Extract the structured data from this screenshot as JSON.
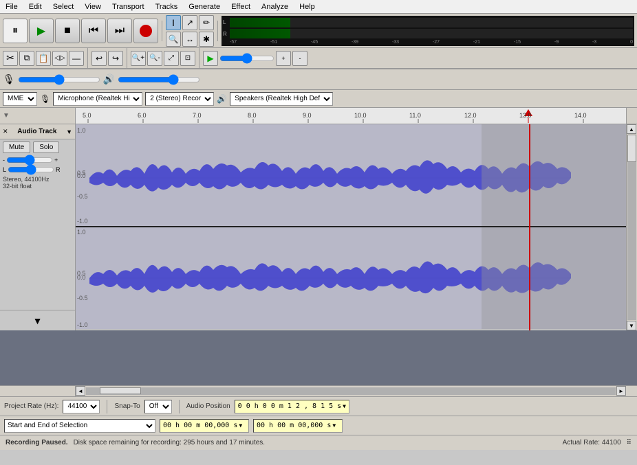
{
  "menu": {
    "items": [
      "File",
      "Edit",
      "Select",
      "View",
      "Transport",
      "Tracks",
      "Generate",
      "Effect",
      "Analyze",
      "Help"
    ]
  },
  "transport": {
    "pause_label": "⏸",
    "play_label": "▶",
    "stop_label": "■",
    "skip_start_label": "⏮",
    "skip_end_label": "⏭",
    "record_label": "⏺"
  },
  "tools": {
    "selection": "I",
    "envelope": "↗",
    "draw": "✏",
    "zoom_label": "🔍",
    "timeshift": "↔",
    "multi": "✱"
  },
  "vu_meter": {
    "l_label": "L",
    "r_label": "R",
    "scale": "-57 -54 -51 -48 -45 -42 -39 -36 -33 -30 -27 -24 -21 -18 -15 -12 -9 -6 -3 0"
  },
  "mixer": {
    "mic_icon": "🎙",
    "speaker_icon": "🔊",
    "mic_volume": 50,
    "speaker_volume": 70
  },
  "devices": {
    "api": "MME",
    "mic_icon": "🎙",
    "mic_device": "Microphone (Realtek High",
    "channels": "2 (Stereo) Recor",
    "speaker_icon": "🔊",
    "speaker_device": "Speakers (Realtek High Defi"
  },
  "ruler": {
    "marks": [
      "5.0",
      "6.0",
      "7.0",
      "8.0",
      "9.0",
      "10.0",
      "11.0",
      "12.0",
      "13.0",
      "14.0"
    ]
  },
  "track": {
    "name": "Audio Track",
    "mute_label": "Mute",
    "solo_label": "Solo",
    "gain_min": "-",
    "gain_max": "+",
    "pan_left": "L",
    "pan_right": "R",
    "info": "Stereo, 44100Hz\n32-bit float"
  },
  "playhead": {
    "position_percent": 72
  },
  "status_bar": {
    "project_rate_label": "Project Rate (Hz):",
    "project_rate_value": "44100",
    "snap_to_label": "Snap-To",
    "snap_to_value": "Off",
    "audio_position_label": "Audio Position",
    "audio_position_value": "0 0 h 0 0 m 1 2 , 8 1 5 s"
  },
  "selection_bar": {
    "label": "Start and End of Selection",
    "start_value": "00 h 00 m 00,000 s",
    "end_value": "00 h 00 m 00,000 s"
  },
  "bottom_status": {
    "left": "Recording Paused.",
    "disk_space": "Disk space remaining for recording: 295 hours and 17 minutes.",
    "actual_rate": "Actual Rate: 44100"
  },
  "zoom_tools": {
    "zoom_in": "+",
    "zoom_out": "-",
    "fit": "⤢",
    "zoom_sel": "⊡"
  },
  "extra_tools": {
    "cut": "✂",
    "copy": "⧉",
    "paste": "📋",
    "trim": "◁▷",
    "silence": "—"
  },
  "playback_tools": {
    "play_green": "▶",
    "zoom_in2": "+",
    "zoom_out2": "-"
  }
}
